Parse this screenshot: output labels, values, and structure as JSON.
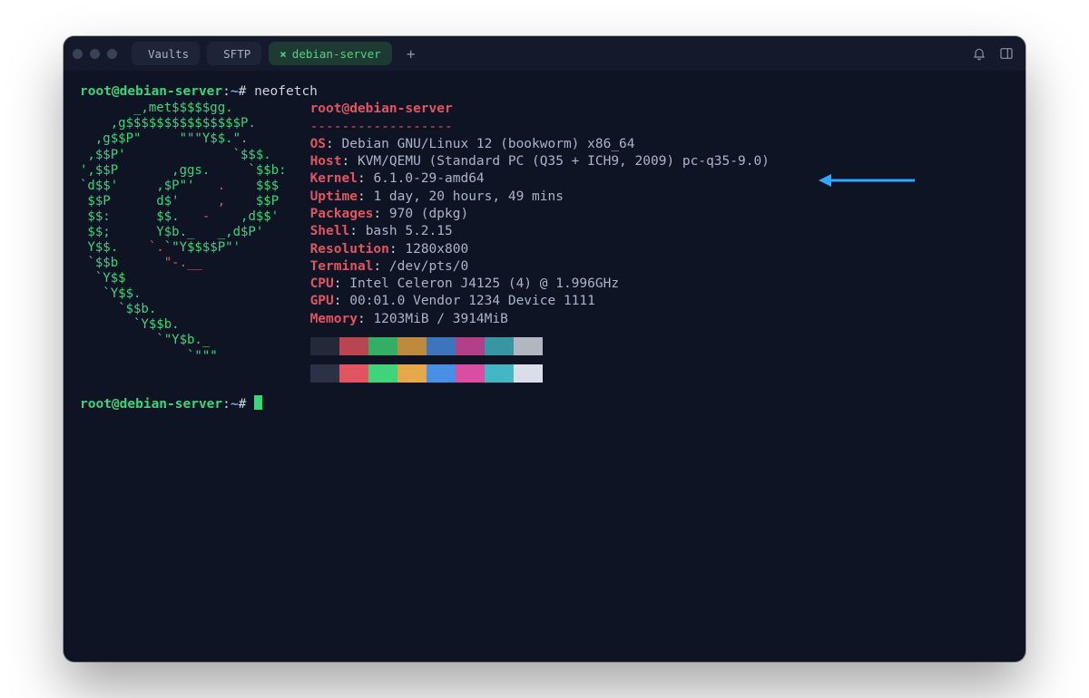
{
  "tabs": [
    {
      "label": "Vaults"
    },
    {
      "label": "SFTP"
    },
    {
      "label": "debian-server",
      "active": true
    }
  ],
  "prompt": {
    "userhost": "root@debian-server",
    "path": "~",
    "symbol": "#",
    "command": "neofetch"
  },
  "info": {
    "userhost": "root@debian-server",
    "separator": "------------------",
    "rows": [
      {
        "k": "OS",
        "v": "Debian GNU/Linux 12 (bookworm) x86_64"
      },
      {
        "k": "Host",
        "v": "KVM/QEMU (Standard PC (Q35 + ICH9, 2009) pc-q35-9.0)"
      },
      {
        "k": "Kernel",
        "v": "6.1.0-29-amd64"
      },
      {
        "k": "Uptime",
        "v": "1 day, 20 hours, 49 mins"
      },
      {
        "k": "Packages",
        "v": "970 (dpkg)"
      },
      {
        "k": "Shell",
        "v": "bash 5.2.15"
      },
      {
        "k": "Resolution",
        "v": "1280x800"
      },
      {
        "k": "Terminal",
        "v": "/dev/pts/0"
      },
      {
        "k": "CPU",
        "v": "Intel Celeron J4125 (4) @ 1.996GHz"
      },
      {
        "k": "GPU",
        "v": "00:01.0 Vendor 1234 Device 1111"
      },
      {
        "k": "Memory",
        "v": "1203MiB / 3914MiB"
      }
    ]
  },
  "palette": [
    "#2b3245",
    "#e05561",
    "#3fd47a",
    "#e6a94a",
    "#4a8fe6",
    "#d84ea3",
    "#43b7c4",
    "#d9dee8"
  ]
}
